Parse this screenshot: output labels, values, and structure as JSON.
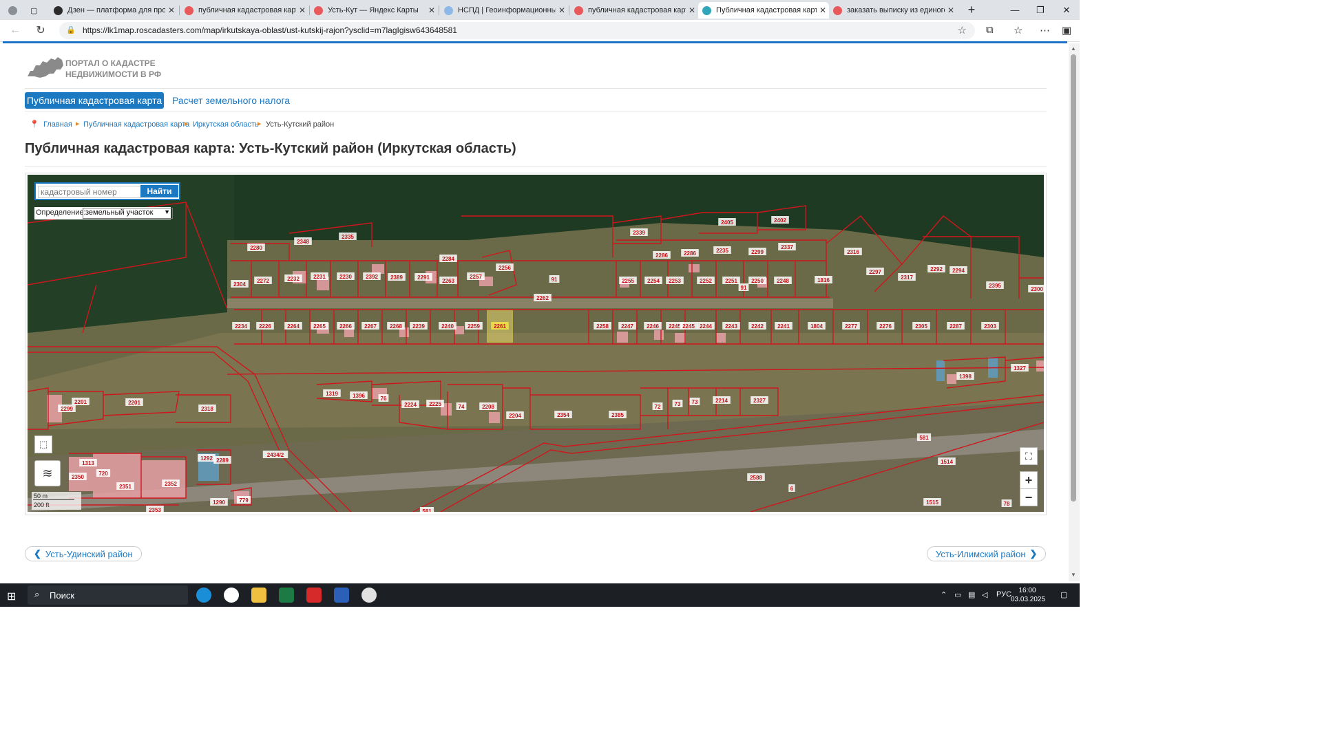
{
  "browser": {
    "tabs": [
      {
        "title": "Дзен — платформа для просм",
        "icon_color": "#2b2b2b",
        "active": false
      },
      {
        "title": "публичная кадастровая карта",
        "icon_color": "#e8595c",
        "active": false
      },
      {
        "title": "Усть-Кут — Яндекс Карты",
        "icon_color": "#e8595c",
        "active": false
      },
      {
        "title": "НСПД | Геоинформационный",
        "icon_color": "#8db8e8",
        "active": false
      },
      {
        "title": "публичная кадастровая карта",
        "icon_color": "#e8595c",
        "active": false
      },
      {
        "title": "Публичная кадастровая карта",
        "icon_color": "#2fa6b9",
        "active": true
      },
      {
        "title": "заказать выписку из единого",
        "icon_color": "#e8595c",
        "active": false
      }
    ],
    "url": "https://lk1map.roscadasters.com/map/irkutskaya-oblast/ust-kutskij-rajon?ysclid=m7lagIgisw643648581",
    "new_tab_label": "+"
  },
  "site": {
    "logo_line1": "ПОРТАЛ О КАДАСТРЕ",
    "logo_line2": "НЕДВИЖИМОСТИ В РФ",
    "nav_active": "Публичная кадастровая карта",
    "nav_link": "Расчет земельного налога",
    "breadcrumb": [
      "Главная",
      "Публичная кадастровая карта",
      "Иркутская область",
      "Усть-Кутский район"
    ],
    "title": "Публичная кадастровая карта: Усть-Кутский район (Иркутская область)"
  },
  "map": {
    "search_placeholder": "кадастровый номер",
    "search_button": "Найти",
    "definition_label": "Определение:",
    "definition_value": "земельный участок",
    "scale_metric": "50 m",
    "scale_imperial": "200 ft",
    "zoom_in": "+",
    "zoom_out": "−",
    "fullscreen": "⛶",
    "highlighted_parcel": "2261",
    "parcel_labels_top_row": [
      "2234",
      "2226",
      "2264",
      "2265",
      "2266",
      "2267",
      "2268",
      "2239",
      "2240",
      "2259",
      "2261",
      "2258",
      "2247",
      "2246",
      "2245",
      "2245",
      "2244",
      "2243",
      "2242",
      "2241",
      "1804",
      "2277",
      "2276",
      "2305",
      "2287",
      "2303"
    ],
    "parcel_labels_upper": [
      "2280",
      "2348",
      "2335",
      "2284",
      "2256",
      "2339",
      "2405",
      "2402",
      "2337",
      "2286",
      "2286",
      "2235",
      "2299",
      "2316",
      "2297",
      "2317",
      "2292",
      "2294",
      "2395",
      "2300",
      "2304",
      "2272",
      "2232",
      "2231",
      "2230",
      "2392",
      "2389",
      "2291",
      "2263",
      "2257",
      "91",
      "2255",
      "2254",
      "2253",
      "2252",
      "2251",
      "91",
      "2250",
      "2248",
      "1816",
      "2262"
    ],
    "parcel_labels_lower": [
      "1319",
      "1396",
      "76",
      "2224",
      "2225",
      "74",
      "2208",
      "2204",
      "2354",
      "2385",
      "72",
      "73",
      "73",
      "2214",
      "2327",
      "1398",
      "1327",
      "2299",
      "2201",
      "2201",
      "2318",
      "1292",
      "2289",
      "2350",
      "1313",
      "720",
      "2351",
      "2352",
      "2353",
      "1290",
      "779",
      "2434/2",
      "581",
      "1514",
      "2588",
      "6",
      "1515",
      "78",
      "581"
    ]
  },
  "pagination": {
    "prev": "Усть-Удинский район",
    "next": "Усть-Илимский район"
  },
  "taskbar": {
    "search_label": "Поиск",
    "lang": "РУС",
    "time": "16:00",
    "date": "03.03.2025"
  }
}
